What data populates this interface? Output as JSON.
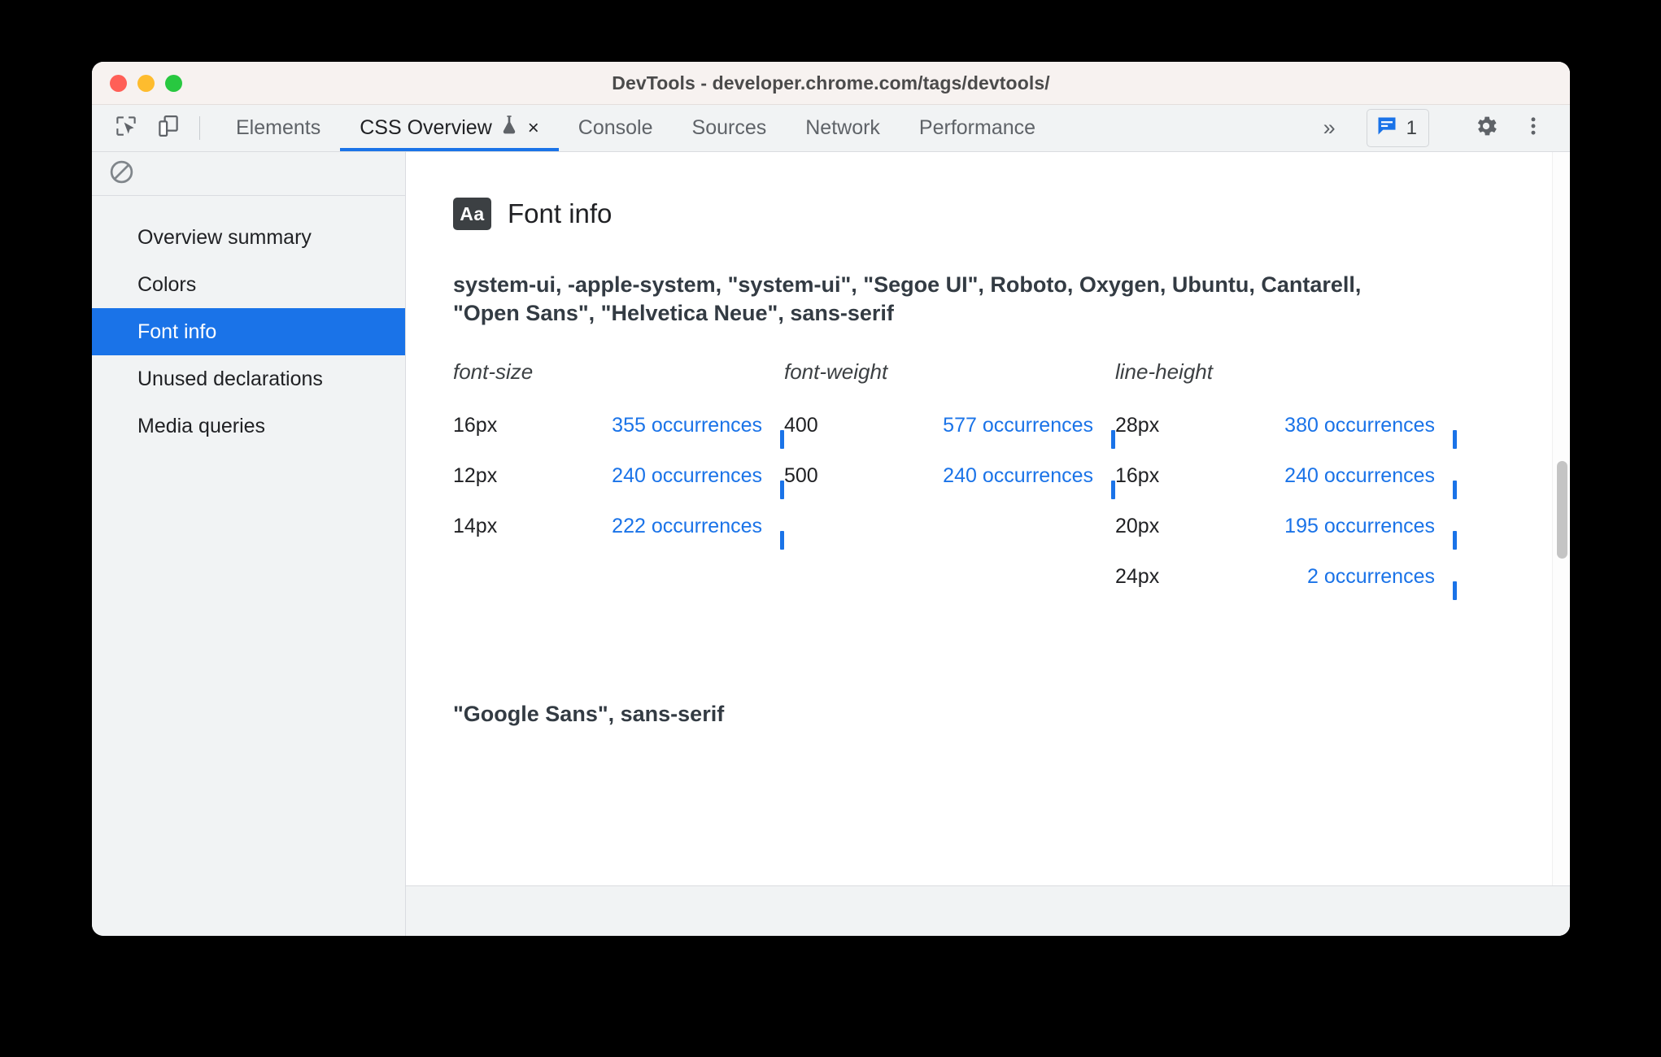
{
  "window": {
    "title": "DevTools - developer.chrome.com/tags/devtools/",
    "controls": {
      "close": "close-window",
      "minimize": "minimize-window",
      "maximize": "maximize-window"
    }
  },
  "toolbar": {
    "inspect_icon": "inspect-element-icon",
    "device_icon": "device-toolbar-icon",
    "overflow_label": "»",
    "issues_icon": "issues-message-icon",
    "issues_count": "1",
    "settings_icon": "gear-icon",
    "menu_icon": "kebab-menu-icon"
  },
  "tabs": [
    {
      "label": "Elements",
      "active": false,
      "experimental": false,
      "closable": false
    },
    {
      "label": "CSS Overview",
      "active": true,
      "experimental": true,
      "closable": true,
      "experiment_icon": "flask-icon",
      "close_label": "×"
    },
    {
      "label": "Console",
      "active": false,
      "experimental": false,
      "closable": false
    },
    {
      "label": "Sources",
      "active": false,
      "experimental": false,
      "closable": false
    },
    {
      "label": "Network",
      "active": false,
      "experimental": false,
      "closable": false
    },
    {
      "label": "Performance",
      "active": false,
      "experimental": false,
      "closable": false
    }
  ],
  "sidebar": {
    "clear_icon": "clear-overview-icon",
    "items": [
      {
        "label": "Overview summary",
        "selected": false
      },
      {
        "label": "Colors",
        "selected": false
      },
      {
        "label": "Font info",
        "selected": true
      },
      {
        "label": "Unused declarations",
        "selected": false
      },
      {
        "label": "Media queries",
        "selected": false
      }
    ]
  },
  "panel": {
    "badge": "Aa",
    "badge_icon": "font-badge-icon",
    "title": "Font info",
    "font_families": [
      {
        "stack": "system-ui, -apple-system, \"system-ui\", \"Segoe UI\", Roboto, Oxygen, Ubuntu, Cantarell, \"Open Sans\", \"Helvetica Neue\", sans-serif",
        "columns": [
          {
            "header": "font-size",
            "rows": [
              {
                "key": "16px",
                "value": "355 occurrences"
              },
              {
                "key": "12px",
                "value": "240 occurrences"
              },
              {
                "key": "14px",
                "value": "222 occurrences"
              }
            ]
          },
          {
            "header": "font-weight",
            "rows": [
              {
                "key": "400",
                "value": "577 occurrences"
              },
              {
                "key": "500",
                "value": "240 occurrences"
              }
            ]
          },
          {
            "header": "line-height",
            "rows": [
              {
                "key": "28px",
                "value": "380 occurrences"
              },
              {
                "key": "16px",
                "value": "240 occurrences"
              },
              {
                "key": "20px",
                "value": "195 occurrences"
              },
              {
                "key": "24px",
                "value": "2 occurrences"
              }
            ]
          }
        ]
      },
      {
        "stack": "\"Google Sans\", sans-serif",
        "columns": []
      }
    ]
  },
  "colors": {
    "accent_blue": "#1a73e8",
    "link_blue": "#1a73e8",
    "sidebar_bg": "#f1f3f4",
    "titlebar_bg": "#f7f2f0",
    "badge_dark": "#3c4043",
    "text_dark": "#202124"
  }
}
